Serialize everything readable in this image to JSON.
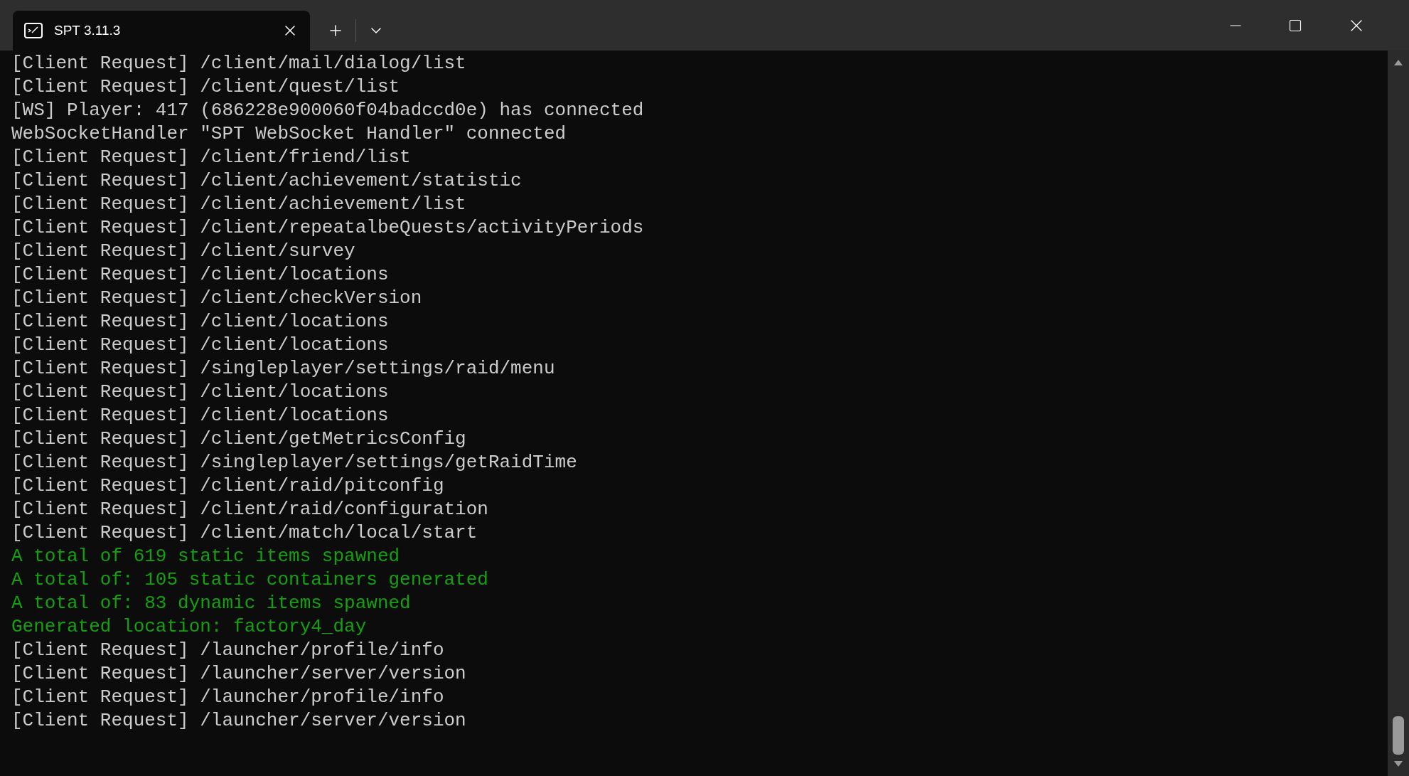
{
  "window": {
    "tab": {
      "title": "SPT 3.11.3",
      "selected": true
    }
  },
  "lines": [
    {
      "kind": "normal",
      "text": "[Client Request] /client/mail/dialog/list"
    },
    {
      "kind": "normal",
      "text": "[Client Request] /client/quest/list"
    },
    {
      "kind": "normal",
      "text": "[WS] Player: 417 (686228e900060f04badccd0e) has connected"
    },
    {
      "kind": "normal",
      "text": "WebSocketHandler \"SPT WebSocket Handler\" connected"
    },
    {
      "kind": "normal",
      "text": "[Client Request] /client/friend/list"
    },
    {
      "kind": "normal",
      "text": "[Client Request] /client/achievement/statistic"
    },
    {
      "kind": "normal",
      "text": "[Client Request] /client/achievement/list"
    },
    {
      "kind": "normal",
      "text": "[Client Request] /client/repeatalbeQuests/activityPeriods"
    },
    {
      "kind": "normal",
      "text": "[Client Request] /client/survey"
    },
    {
      "kind": "normal",
      "text": "[Client Request] /client/locations"
    },
    {
      "kind": "normal",
      "text": "[Client Request] /client/checkVersion"
    },
    {
      "kind": "normal",
      "text": "[Client Request] /client/locations"
    },
    {
      "kind": "normal",
      "text": "[Client Request] /client/locations"
    },
    {
      "kind": "normal",
      "text": "[Client Request] /singleplayer/settings/raid/menu"
    },
    {
      "kind": "normal",
      "text": "[Client Request] /client/locations"
    },
    {
      "kind": "normal",
      "text": "[Client Request] /client/locations"
    },
    {
      "kind": "normal",
      "text": "[Client Request] /client/getMetricsConfig"
    },
    {
      "kind": "normal",
      "text": "[Client Request] /singleplayer/settings/getRaidTime"
    },
    {
      "kind": "normal",
      "text": "[Client Request] /client/raid/pitconfig"
    },
    {
      "kind": "normal",
      "text": "[Client Request] /client/raid/configuration"
    },
    {
      "kind": "normal",
      "text": "[Client Request] /client/match/local/start"
    },
    {
      "kind": "success",
      "text": "A total of 619 static items spawned"
    },
    {
      "kind": "success",
      "text": "A total of: 105 static containers generated"
    },
    {
      "kind": "success",
      "text": "A total of: 83 dynamic items spawned"
    },
    {
      "kind": "success",
      "text": "Generated location: factory4_day"
    },
    {
      "kind": "normal",
      "text": "[Client Request] /launcher/profile/info"
    },
    {
      "kind": "normal",
      "text": "[Client Request] /launcher/server/version"
    },
    {
      "kind": "normal",
      "text": "[Client Request] /launcher/profile/info"
    },
    {
      "kind": "normal",
      "text": "[Client Request] /launcher/server/version"
    }
  ]
}
